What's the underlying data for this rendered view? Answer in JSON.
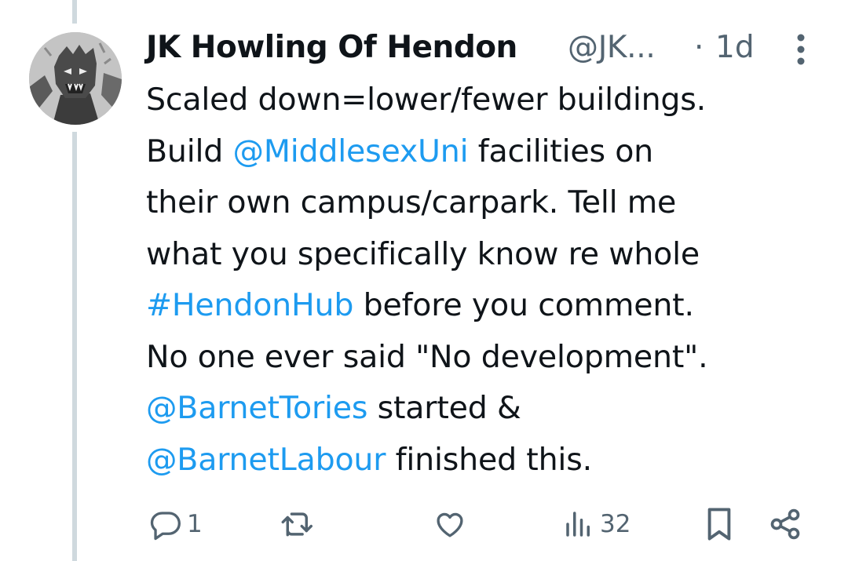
{
  "tweet": {
    "author": {
      "display_name": "JK Howling Of Hendon",
      "handle": "@JK...",
      "avatar": "werewolf-avatar"
    },
    "separator": "·",
    "time": "1d",
    "text": {
      "l1": "Scaled down=lower/fewer buildings.",
      "l2_a": "Build ",
      "l2_link": "@MiddlesexUni",
      "l2_b": " facilities on",
      "l3": "their own campus/carpark. Tell me",
      "l4": "what you specifically know re whole",
      "l5_link": "#HendonHub",
      "l5_b": " before you comment.",
      "l6": "No one ever said \"No development\".",
      "l7_link": "@BarnetTories",
      "l7_b": " started &",
      "l8_link": "@BarnetLabour",
      "l8_b": " finished this."
    },
    "actions": {
      "reply": {
        "icon": "reply-icon",
        "count": "1"
      },
      "repost": {
        "icon": "repost-icon",
        "count": ""
      },
      "like": {
        "icon": "heart-icon",
        "count": ""
      },
      "views": {
        "icon": "views-icon",
        "count": "32"
      },
      "bookmark": {
        "icon": "bookmark-icon"
      },
      "share": {
        "icon": "share-icon"
      }
    }
  },
  "colors": {
    "text": "#0f1419",
    "muted": "#536471",
    "link": "#1d9bf0",
    "thread_line": "#cfd9de"
  }
}
